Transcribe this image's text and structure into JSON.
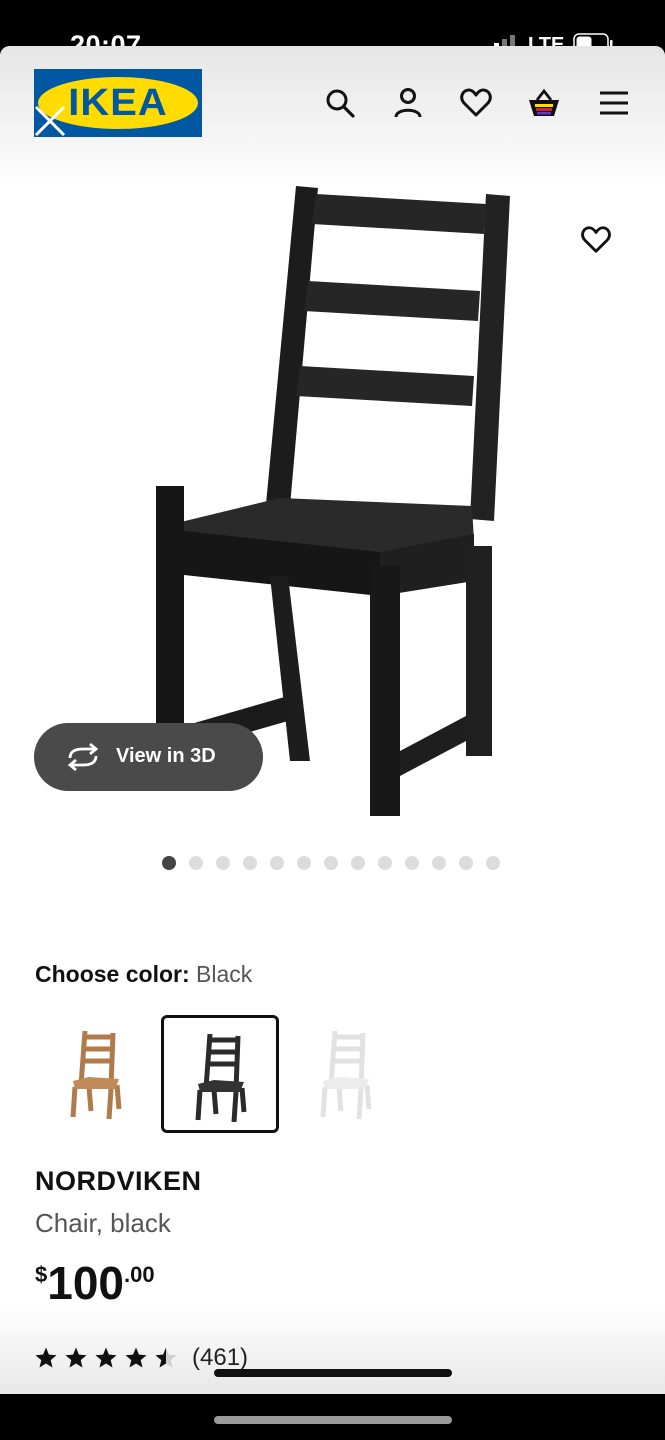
{
  "status_bar": {
    "time": "20:07",
    "network": "LTE"
  },
  "brand": {
    "logo_text": "IKEA",
    "blue": "#0058a3",
    "yellow": "#ffdb00"
  },
  "nav": {
    "icons": [
      "search-icon",
      "account-icon",
      "favorites-icon",
      "cart-icon",
      "menu-icon"
    ]
  },
  "gallery": {
    "view_3d_label": "View in 3D",
    "image_count": 13,
    "active_index": 0
  },
  "color_chooser": {
    "label": "Choose color:",
    "selected": "Black",
    "options": [
      {
        "name": "brown",
        "color": "#b07a4a"
      },
      {
        "name": "black",
        "color": "#2b2b2b"
      },
      {
        "name": "white",
        "color": "#e6e6e6"
      }
    ]
  },
  "product": {
    "name": "NORDVIKEN",
    "description": "Chair, black",
    "price_currency": "$",
    "price_integer": "100",
    "price_decimal": ".00"
  },
  "rating": {
    "stars": 4.5,
    "count": "(461)"
  }
}
